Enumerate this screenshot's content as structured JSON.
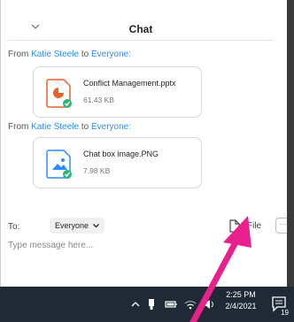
{
  "chat": {
    "title": "Chat",
    "messages": [
      {
        "from_prefix": "From",
        "sender": "Katie Steele",
        "to_word": "to",
        "recipient": "Everyone:",
        "file_name": "Conflict Management.pptx",
        "file_size": "61.43 KB",
        "file_icon": "powerpoint-file-icon"
      },
      {
        "from_prefix": "From",
        "sender": "Katie Steele",
        "to_word": "to",
        "recipient": "Everyone:",
        "file_name": "Chat box image.PNG",
        "file_size": "7.98 KB",
        "file_icon": "image-file-icon"
      }
    ]
  },
  "compose": {
    "to_label": "To:",
    "recipient": "Everyone",
    "file_button": "File",
    "more_button": "···",
    "placeholder": "Type message here..."
  },
  "taskbar": {
    "time": "2:25 PM",
    "date": "2/4/2021",
    "notification_count": "19"
  },
  "colors": {
    "accent": "#2d8cff",
    "badge_green": "#2bb673",
    "ppt_orange": "#e8622c",
    "annotation_arrow": "#e8218c",
    "taskbar": "#1f2a36"
  }
}
